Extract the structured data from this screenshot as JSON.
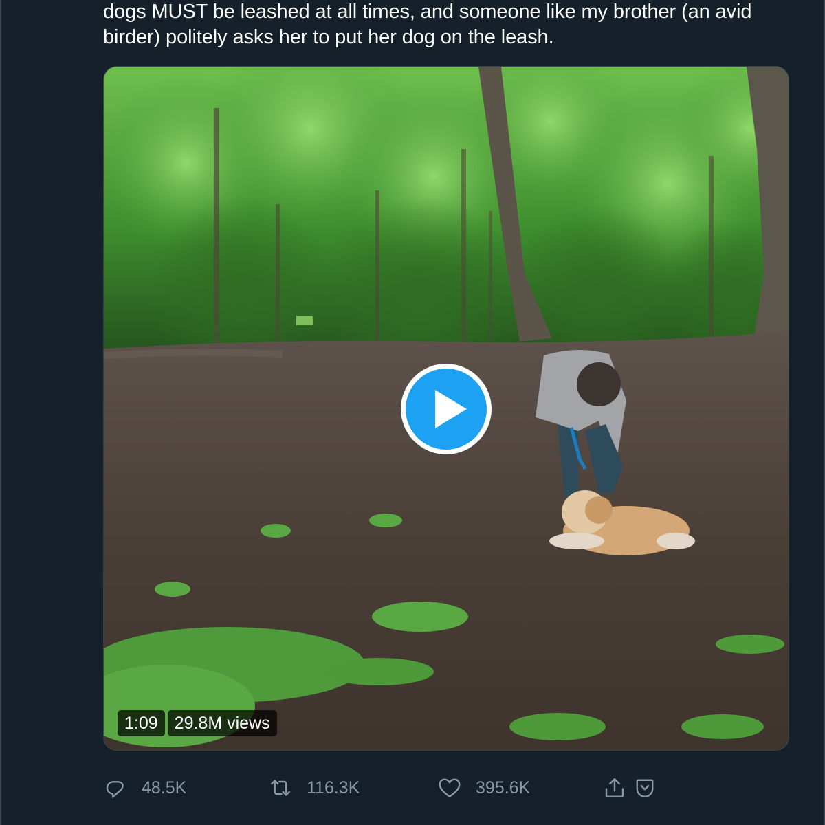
{
  "tweet": {
    "text_lines": [
      "dogs MUST be leashed at all times, and someone like my brother (an avid",
      "birder) politely asks her to put her dog on the leash."
    ]
  },
  "video": {
    "duration": "1:09",
    "views": "29.8M views",
    "play_icon": "play-icon",
    "accent_color": "#1da1f2"
  },
  "actions": {
    "reply": {
      "icon": "reply-icon",
      "count": "48.5K"
    },
    "retweet": {
      "icon": "retweet-icon",
      "count": "116.3K"
    },
    "like": {
      "icon": "heart-icon",
      "count": "395.6K"
    },
    "share": {
      "icon": "share-icon"
    },
    "bookmark": {
      "icon": "bookmark-icon"
    }
  },
  "theme": {
    "background": "#15202b",
    "text": "#ffffff",
    "muted": "#8899a6",
    "border": "#38444d"
  }
}
